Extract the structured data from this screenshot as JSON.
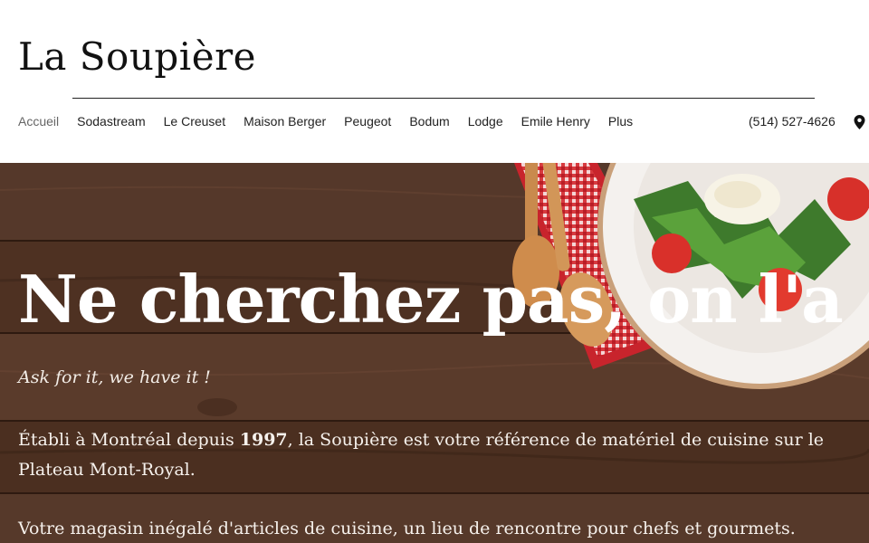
{
  "site": {
    "logo": "La Soupière"
  },
  "nav": {
    "items": [
      {
        "label": "Accueil",
        "active": true
      },
      {
        "label": "Sodastream"
      },
      {
        "label": "Le Creuset"
      },
      {
        "label": "Maison Berger"
      },
      {
        "label": "Peugeot"
      },
      {
        "label": "Bodum"
      },
      {
        "label": "Lodge"
      },
      {
        "label": "Emile Henry"
      },
      {
        "label": "Plus"
      }
    ]
  },
  "contact": {
    "phone": "(514) 527-4626",
    "map_icon": "map-pin-icon"
  },
  "hero": {
    "title": "Ne cherchez pas, on l'a !",
    "tagline": "Ask for it, we have it !",
    "para1_before": "Établi à Montréal depuis ",
    "para1_year": "1997",
    "para1_after": ", la Soupière est votre référence de matériel de cuisine sur le Plateau Mont-Royal.",
    "para2": "Votre magasin inégalé d'articles de cuisine, un lieu de rencontre pour chefs et gourmets."
  },
  "colors": {
    "wood": "#4d3020",
    "text_on_hero": "#ffffff",
    "nav_active": "#666666"
  }
}
